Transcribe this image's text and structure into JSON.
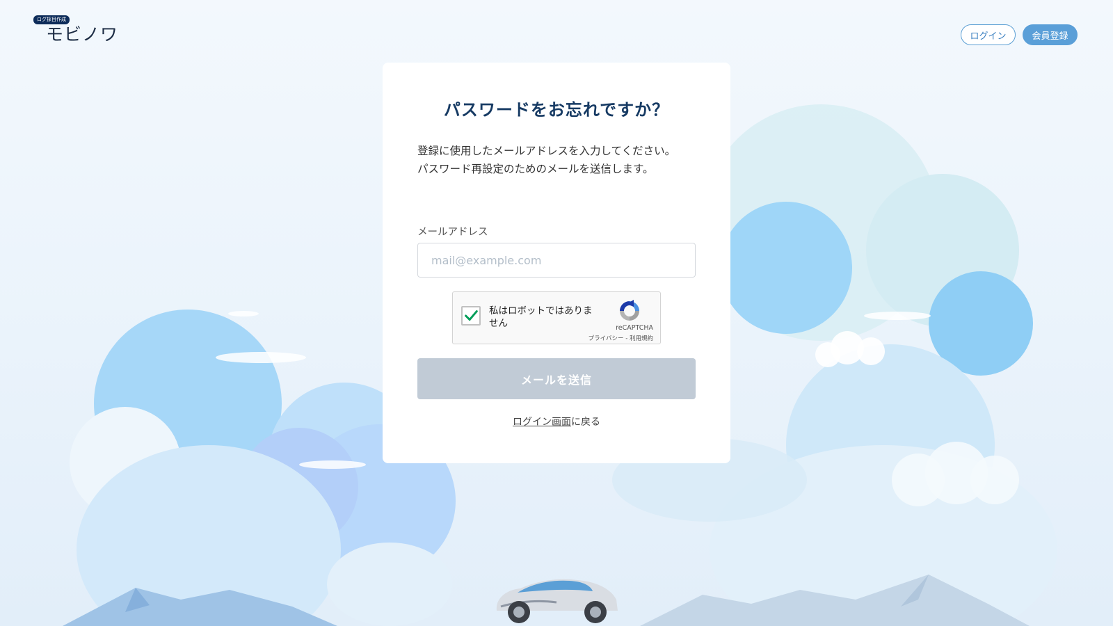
{
  "header": {
    "logo_badge": "ログ採目作成",
    "logo_text": "モビノワ",
    "login_label": "ログイン",
    "register_label": "会員登録"
  },
  "card": {
    "title": "パスワードをお忘れですか？",
    "description": "登録に使用したメールアドレスを入力してください。パスワード再設定のためのメールを送信します。",
    "email_label": "メールアドレス",
    "email_placeholder": "mail@example.com",
    "email_value": "",
    "submit_label": "メールを送信",
    "submit_enabled": false,
    "back_link_label": "ログイン画面",
    "back_suffix": "に戻る"
  },
  "recaptcha": {
    "checked": true,
    "label": "私はロボットではありません",
    "brand": "reCAPTCHA",
    "privacy_label": "プライバシー",
    "separator": " - ",
    "terms_label": "利用規約"
  },
  "colors": {
    "title": "#163a63",
    "accent": "#5a9fd8",
    "submit_disabled": "#c1cbd6",
    "check_green": "#009d58"
  }
}
